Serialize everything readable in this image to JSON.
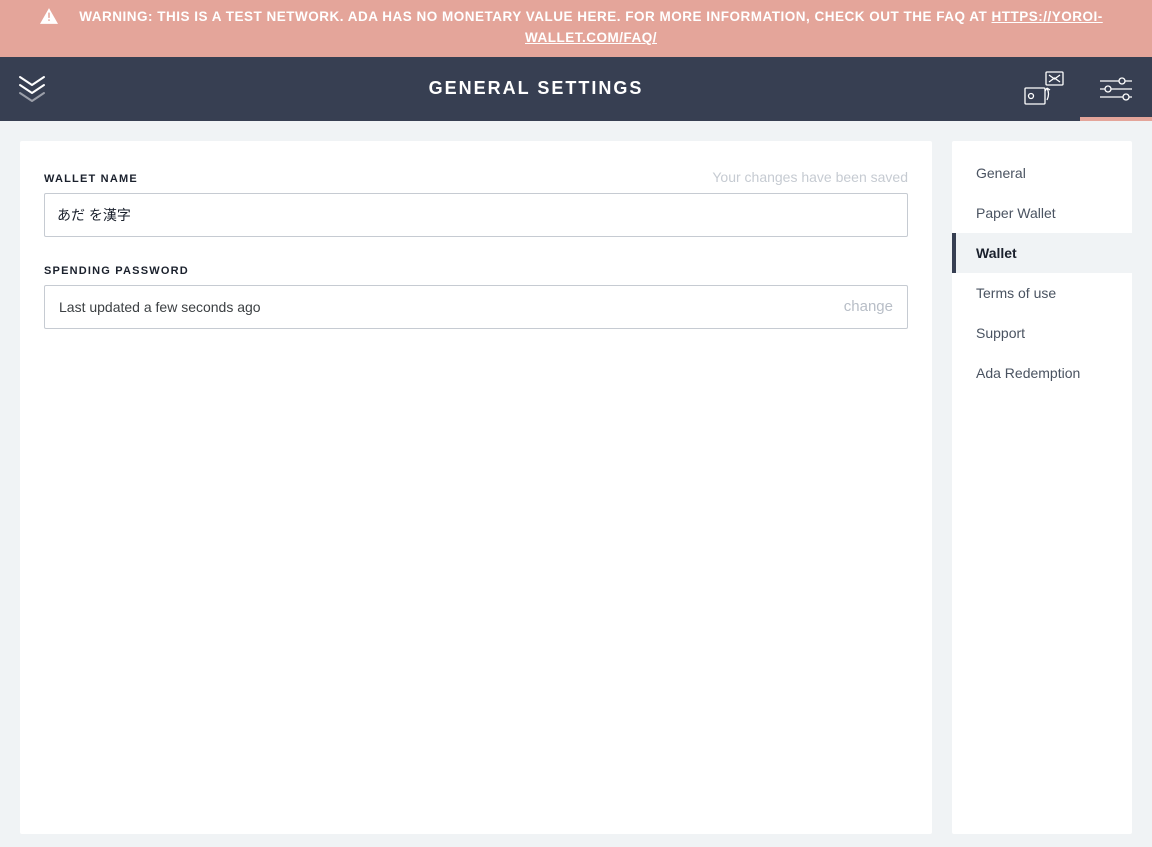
{
  "banner": {
    "prefix": "WARNING: THIS IS A TEST NETWORK. ADA HAS NO MONETARY VALUE HERE. FOR MORE INFORMATION, CHECK OUT THE FAQ AT ",
    "link_text": "HTTPS://YOROI-WALLET.COM/FAQ/"
  },
  "header": {
    "title": "GENERAL SETTINGS"
  },
  "form": {
    "wallet_name_label": "WALLET NAME",
    "wallet_name_value": "あだ を漢字",
    "saved_message": "Your changes have been saved",
    "spending_password_label": "SPENDING PASSWORD",
    "spending_password_status": "Last updated a few seconds ago",
    "change_action": "change"
  },
  "sidebar": {
    "items": [
      {
        "label": "General",
        "active": false
      },
      {
        "label": "Paper Wallet",
        "active": false
      },
      {
        "label": "Wallet",
        "active": true
      },
      {
        "label": "Terms of use",
        "active": false
      },
      {
        "label": "Support",
        "active": false
      },
      {
        "label": "Ada Redemption",
        "active": false
      }
    ]
  }
}
